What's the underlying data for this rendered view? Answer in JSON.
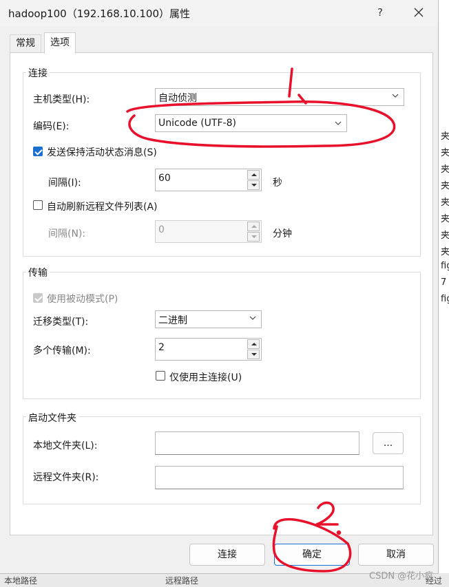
{
  "window": {
    "title": "hadoop100（192.168.10.100）属性",
    "help": "?"
  },
  "tabs": [
    {
      "label": "常规"
    },
    {
      "label": "选项"
    }
  ],
  "connection": {
    "group_label": "连接",
    "host_type_label": "主机类型(H):",
    "host_type_value": "自动侦测",
    "encoding_label": "编码(E):",
    "encoding_value": "Unicode (UTF-8)",
    "keepalive_label": "发送保持活动状态消息(S)",
    "keepalive_checked": true,
    "interval_label": "间隔(I):",
    "interval_value": "60",
    "interval_unit": "秒",
    "auto_refresh_label": "自动刷新远程文件列表(A)",
    "auto_refresh_checked": false,
    "refresh_interval_label": "间隔(N):",
    "refresh_interval_value": "0",
    "refresh_interval_unit": "分钟"
  },
  "transfer": {
    "group_label": "传输",
    "passive_label": "使用被动模式(P)",
    "passive_checked": true,
    "migrate_type_label": "迁移类型(T):",
    "migrate_type_value": "二进制",
    "multi_transfer_label": "多个传输(M):",
    "multi_transfer_value": "2",
    "main_conn_only_label": "仅使用主连接(U)",
    "main_conn_only_checked": false
  },
  "startup": {
    "group_label": "启动文件夹",
    "local_label": "本地文件夹(L):",
    "local_value": "",
    "browse_label": "...",
    "remote_label": "远程文件夹(R):",
    "remote_value": ""
  },
  "footer": {
    "connect": "连接",
    "ok": "确定",
    "cancel": "取消"
  },
  "annotations": {
    "mark1": "1、",
    "mark2": "2."
  },
  "background": {
    "right_items": [
      "夹",
      "夹",
      "夹",
      "夹",
      "夹",
      "夹",
      "夹",
      "夹",
      "fig",
      "7 x",
      "fig"
    ],
    "bottom_left": "本地路径",
    "bottom_mid": "远程路径",
    "bottom_right": "经过"
  },
  "watermark": "CSDN @花小疯",
  "colors": {
    "accent": "#1a6fd0",
    "annotation": "#e8102a"
  }
}
